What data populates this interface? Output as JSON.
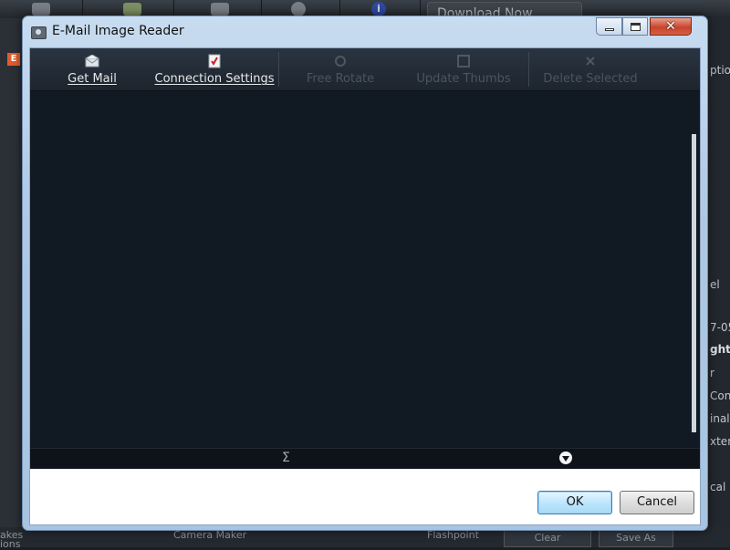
{
  "background_app": {
    "download_label": "Download Now",
    "right_panel_texts": [
      "ptio",
      "el",
      "7-05",
      "ght",
      "r",
      "Con",
      "inal",
      "xten",
      "cal"
    ],
    "bottom_texts": [
      "akes",
      "ions",
      "Camera Maker",
      "Flashpoint"
    ],
    "bottom_buttons": [
      "Clear",
      "Save As"
    ],
    "info_glyph": "i"
  },
  "dialog": {
    "title": "E-Mail Image Reader",
    "window_controls": {
      "minimize": "minimize",
      "maximize": "maximize",
      "close": "close"
    },
    "toolbar": {
      "items": [
        {
          "label": "Get Mail",
          "icon": "mail-icon",
          "enabled": true
        },
        {
          "label": "Connection Settings",
          "icon": "settings-document-icon",
          "enabled": true
        },
        {
          "label": "Free Rotate",
          "icon": "rotate-icon",
          "enabled": false
        },
        {
          "label": "Update Thumbs",
          "icon": "thumbs-icon",
          "enabled": false
        },
        {
          "label": "Delete Selected",
          "icon": "delete-x-icon",
          "enabled": false
        }
      ]
    },
    "status": {
      "sum_symbol": "Σ"
    },
    "buttons": {
      "ok": "OK",
      "cancel": "Cancel"
    }
  },
  "colors": {
    "content_bg": "#111923",
    "toolbar_bg": "#1d252e",
    "close_button": "#c8442c",
    "frame": "#a9c4e0"
  }
}
